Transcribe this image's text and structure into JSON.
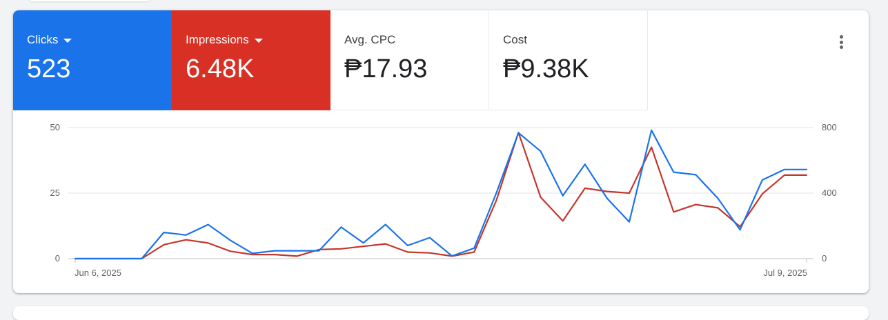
{
  "metrics": {
    "clicks": {
      "label": "Clicks",
      "value": "523",
      "color": "#1a73e8"
    },
    "impressions": {
      "label": "Impressions",
      "value": "6.48K",
      "color": "#d93025"
    },
    "avg_cpc": {
      "label": "Avg. CPC",
      "value": "₱17.93"
    },
    "cost": {
      "label": "Cost",
      "value": "₱9.38K"
    }
  },
  "menu": {
    "icon": "more-vert-icon"
  },
  "chart_data": {
    "type": "line",
    "x": [
      "Jun 6",
      "Jun 7",
      "Jun 8",
      "Jun 9",
      "Jun 10",
      "Jun 11",
      "Jun 12",
      "Jun 13",
      "Jun 14",
      "Jun 15",
      "Jun 16",
      "Jun 17",
      "Jun 18",
      "Jun 19",
      "Jun 20",
      "Jun 21",
      "Jun 22",
      "Jun 23",
      "Jun 24",
      "Jun 25",
      "Jun 26",
      "Jun 27",
      "Jun 28",
      "Jun 29",
      "Jun 30",
      "Jul 1",
      "Jul 2",
      "Jul 3",
      "Jul 4",
      "Jul 5",
      "Jul 6",
      "Jul 7",
      "Jul 8",
      "Jul 9"
    ],
    "x_tick_labels": [
      "Jun 6, 2025",
      "Jul 9, 2025"
    ],
    "y_left": {
      "ticks": [
        0,
        25,
        50
      ],
      "range": [
        0,
        50
      ]
    },
    "y_right": {
      "ticks": [
        0,
        400,
        800
      ],
      "range": [
        0,
        800
      ]
    },
    "grid": true,
    "series": [
      {
        "name": "Clicks",
        "axis": "left",
        "color": "#1a73e8",
        "values": [
          0,
          0,
          0,
          0,
          10,
          9,
          13,
          7,
          2,
          3,
          3,
          3,
          12,
          6,
          13,
          5,
          8,
          1,
          4,
          25,
          48,
          41,
          24,
          36,
          23,
          14,
          49,
          33,
          32,
          23,
          11,
          30,
          34,
          34
        ]
      },
      {
        "name": "Impressions",
        "axis": "right",
        "color": "#c5362b",
        "values": [
          0,
          0,
          0,
          0,
          85,
          115,
          95,
          45,
          25,
          25,
          15,
          55,
          60,
          75,
          90,
          40,
          35,
          15,
          40,
          355,
          770,
          375,
          230,
          430,
          410,
          400,
          680,
          285,
          330,
          310,
          195,
          395,
          510,
          510
        ]
      }
    ]
  }
}
